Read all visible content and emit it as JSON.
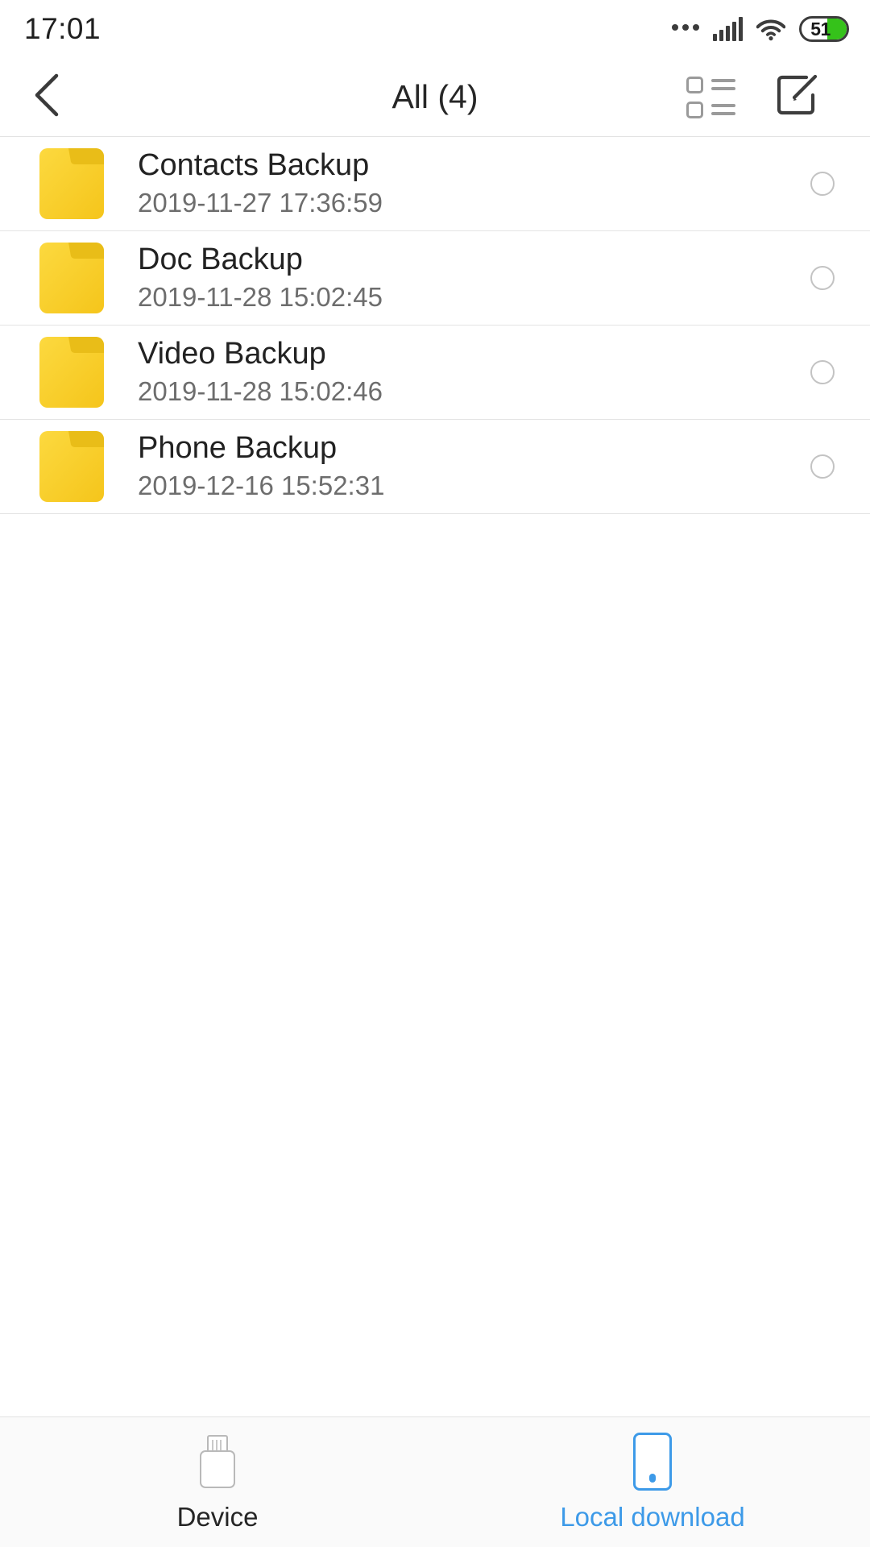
{
  "statusbar": {
    "time": "17:01",
    "overflow_icon": "more-dots-icon",
    "signal_icon": "cellular-signal-icon",
    "wifi_icon": "wifi-icon",
    "battery_percent": "51",
    "battery_fill_color": "#35c21a"
  },
  "header": {
    "back_icon": "back-chevron-icon",
    "title": "All (4)",
    "list_view_icon": "list-view-icon",
    "edit_icon": "edit-compose-icon"
  },
  "files": [
    {
      "icon": "folder-icon",
      "name": "Contacts Backup",
      "date": "2019-11-27 17:36:59",
      "selected": false
    },
    {
      "icon": "folder-icon",
      "name": "Doc Backup",
      "date": "2019-11-28 15:02:45",
      "selected": false
    },
    {
      "icon": "folder-icon",
      "name": "Video Backup",
      "date": "2019-11-28 15:02:46",
      "selected": false
    },
    {
      "icon": "folder-icon",
      "name": "Phone Backup",
      "date": "2019-12-16 15:52:31",
      "selected": false
    }
  ],
  "tabbar": {
    "tabs": [
      {
        "label": "Device",
        "icon": "usb-drive-icon",
        "active": false
      },
      {
        "label": "Local download",
        "icon": "phone-icon",
        "active": true
      }
    ],
    "active_color": "#3d9ae8",
    "inactive_color": "#252525"
  },
  "colors": {
    "folder_yellow": "#fcd535",
    "folder_tab": "#e8bb1c",
    "divider": "#e4e4e4",
    "accent": "#3d9ae8"
  }
}
